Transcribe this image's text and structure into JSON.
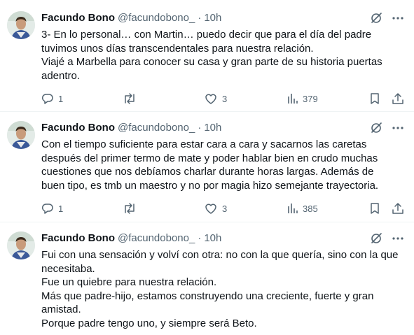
{
  "tweets": [
    {
      "name": "Facundo Bono",
      "handle": "@facundobono_",
      "separator": "·",
      "time": "10h",
      "lines": [
        "3- En lo personal… con Martin… puedo decir que para el día del padre",
        "tuvimos unos días transcendentales para nuestra relación.",
        "Viajé a Marbella para conocer su casa y gran parte de su historia puertas",
        "adentro."
      ],
      "replies": "1",
      "retweets": "",
      "likes": "3",
      "views": "379"
    },
    {
      "name": "Facundo Bono",
      "handle": "@facundobono_",
      "separator": "·",
      "time": "10h",
      "lines": [
        "Con el tiempo suficiente para estar cara a cara y sacarnos las caretas",
        "después del primer termo de mate y poder hablar bien en crudo muchas",
        "cuestiones que nos debíamos charlar durante horas largas. Además de",
        "buen tipo, es tmb un maestro y no por magia hizo semejante trayectoria."
      ],
      "replies": "1",
      "retweets": "",
      "likes": "3",
      "views": "385"
    },
    {
      "name": "Facundo Bono",
      "handle": "@facundobono_",
      "separator": "·",
      "time": "10h",
      "lines": [
        "Fui con una sensación y volví con otra: no con la que quería, sino con la que",
        "necesitaba.",
        "Fue un quiebre para nuestra relación.",
        "Más que padre-hijo, estamos construyendo una creciente, fuerte y gran",
        "amistad.",
        "Porque padre tengo uno, y siempre será Beto."
      ]
    }
  ],
  "icons": {
    "grok": "grok-icon",
    "more": "more-icon",
    "reply": "reply-icon",
    "retweet": "retweet-icon",
    "like": "like-icon",
    "views": "views-icon",
    "bookmark": "bookmark-icon",
    "share": "share-icon"
  },
  "colors": {
    "text": "#0f1419",
    "secondary": "#536471",
    "divider": "#eff3f4",
    "background": "#ffffff"
  }
}
